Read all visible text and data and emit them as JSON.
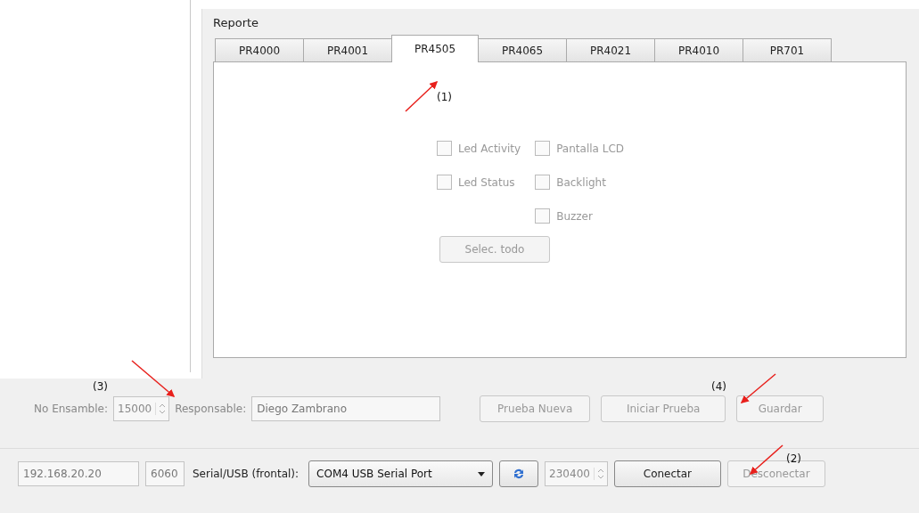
{
  "group": {
    "title": "Reporte"
  },
  "tabs": [
    {
      "label": "PR4000",
      "selected": false
    },
    {
      "label": "PR4001",
      "selected": false
    },
    {
      "label": "PR4505",
      "selected": true
    },
    {
      "label": "PR4065",
      "selected": false
    },
    {
      "label": "PR4021",
      "selected": false
    },
    {
      "label": "PR4010",
      "selected": false
    },
    {
      "label": "PR701",
      "selected": false
    }
  ],
  "checkbox_columns": [
    [
      {
        "label": "Led Activity",
        "checked": false,
        "disabled": true
      },
      {
        "label": "Led Status",
        "checked": false,
        "disabled": true
      }
    ],
    [
      {
        "label": "Pantalla LCD",
        "checked": false,
        "disabled": true
      },
      {
        "label": "Backlight",
        "checked": false,
        "disabled": true
      },
      {
        "label": "Buzzer",
        "checked": false,
        "disabled": true
      }
    ]
  ],
  "select_all_button": {
    "label": "Selec. todo",
    "disabled": true
  },
  "test_row": {
    "assembly_label": "No Ensamble:",
    "assembly_value": "15000",
    "responsible_label": "Responsable:",
    "responsible_value": "Diego Zambrano",
    "disabled": true,
    "buttons": [
      {
        "label": "Prueba Nueva",
        "disabled": true
      },
      {
        "label": "Iniciar Prueba",
        "disabled": true
      },
      {
        "label": "Guardar",
        "disabled": true
      }
    ]
  },
  "connection_row": {
    "ip": "192.168.20.20",
    "port": "6060",
    "fields_disabled": true,
    "serial_label": "Serial/USB (frontal):",
    "serial_port": "COM4 USB Serial Port",
    "baud": "230400",
    "baud_disabled": true,
    "buttons": [
      {
        "label": "Conectar",
        "disabled": false
      },
      {
        "label": "Desconectar",
        "disabled": true
      }
    ]
  },
  "annotations": [
    {
      "label": "(1)"
    },
    {
      "label": "(3)"
    },
    {
      "label": "(4)"
    },
    {
      "label": "(2)"
    }
  ]
}
